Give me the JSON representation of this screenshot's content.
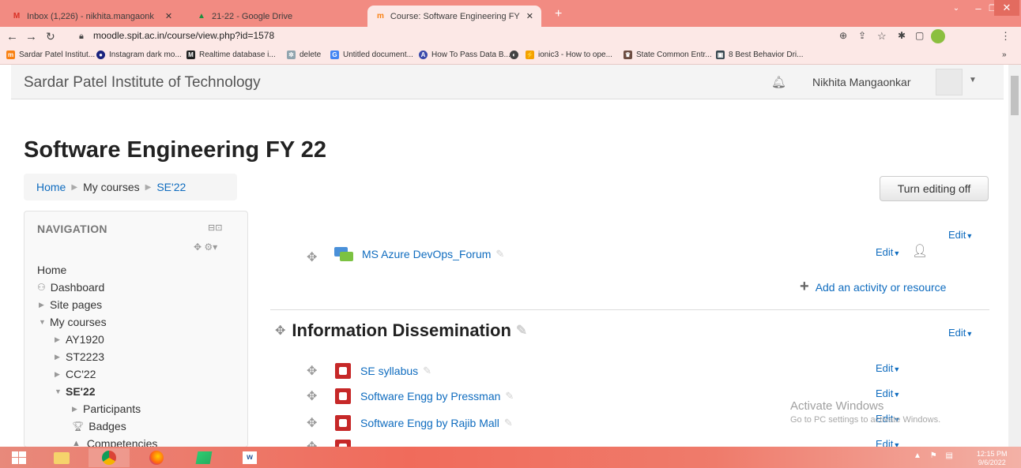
{
  "browser": {
    "tabs": [
      {
        "title": "Inbox (1,226) - nikhita.mangaonk",
        "favicon": "gmail-icon"
      },
      {
        "title": "21-22 - Google Drive",
        "favicon": "drive-icon"
      },
      {
        "title": "Course: Software Engineering FY",
        "favicon": "moodle-icon"
      }
    ],
    "url": "moodle.spit.ac.in/course/view.php?id=1578",
    "bookmarks": [
      "Sardar Patel Institut...",
      "Instagram dark mo...",
      "Realtime database i...",
      "delete",
      "Untitled document...",
      "How To Pass Data B...",
      "ionic3 - How to ope...",
      "State Common Entr...",
      "8 Best Behavior Dri..."
    ]
  },
  "header": {
    "site_name": "Sardar Patel Institute of Technology",
    "user_name": "Nikhita Mangaonkar"
  },
  "page": {
    "title": "Software Engineering FY 22",
    "breadcrumb": [
      "Home",
      "My courses",
      "SE'22"
    ],
    "edit_toggle": "Turn editing off"
  },
  "navigation": {
    "heading": "NAVIGATION",
    "items": [
      {
        "label": "Home"
      },
      {
        "label": "Dashboard"
      },
      {
        "label": "Site pages"
      },
      {
        "label": "My courses"
      },
      {
        "label": "AY1920"
      },
      {
        "label": "ST2223"
      },
      {
        "label": "CC'22"
      },
      {
        "label": "SE'22"
      },
      {
        "label": "Participants"
      },
      {
        "label": "Badges"
      },
      {
        "label": "Competencies"
      }
    ]
  },
  "content": {
    "edit_label": "Edit",
    "forum": "MS Azure DevOps_Forum",
    "add_activity": "Add an activity or resource",
    "section_title": "Information Dissemination",
    "resources": [
      "SE syllabus",
      "Software Engg by Pressman",
      "Software Engg by Rajib Mall"
    ]
  },
  "watermark": {
    "line1": "Activate Windows",
    "line2": "Go to PC settings to activate Windows."
  },
  "taskbar": {
    "time": "12:15 PM",
    "date": "9/6/2022"
  }
}
